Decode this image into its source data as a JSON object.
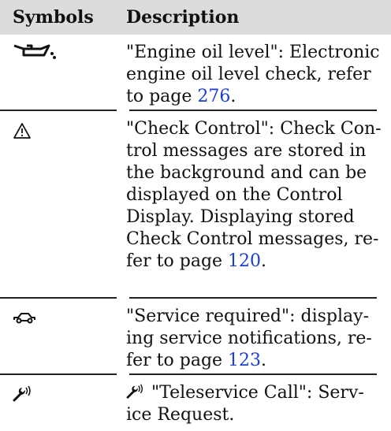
{
  "table": {
    "headers": {
      "symbols": "Symbols",
      "description": "Description"
    },
    "rows": [
      {
        "icon": "oil-can-icon",
        "description": "\"Engine oil level\": Electronic engine oil level check, refer to page ",
        "page": "276",
        "suffix": "."
      },
      {
        "icon": "warning-triangle-icon",
        "description": "\"Check Control\": Check Con­trol messages are stored in the background and can be displayed on the Control Display. Displaying stored Check Control messages, re­fer to page ",
        "page": "120",
        "suffix": "."
      },
      {
        "icon": "car-service-icon",
        "description": "\"Service required\": display­ing service notifications, re­fer to page ",
        "page": "123",
        "suffix": "."
      },
      {
        "icon": "wrench-signal-icon",
        "description": "\"Teleservice Call\": Serv­ice Request.",
        "page": "",
        "suffix": ""
      }
    ]
  }
}
